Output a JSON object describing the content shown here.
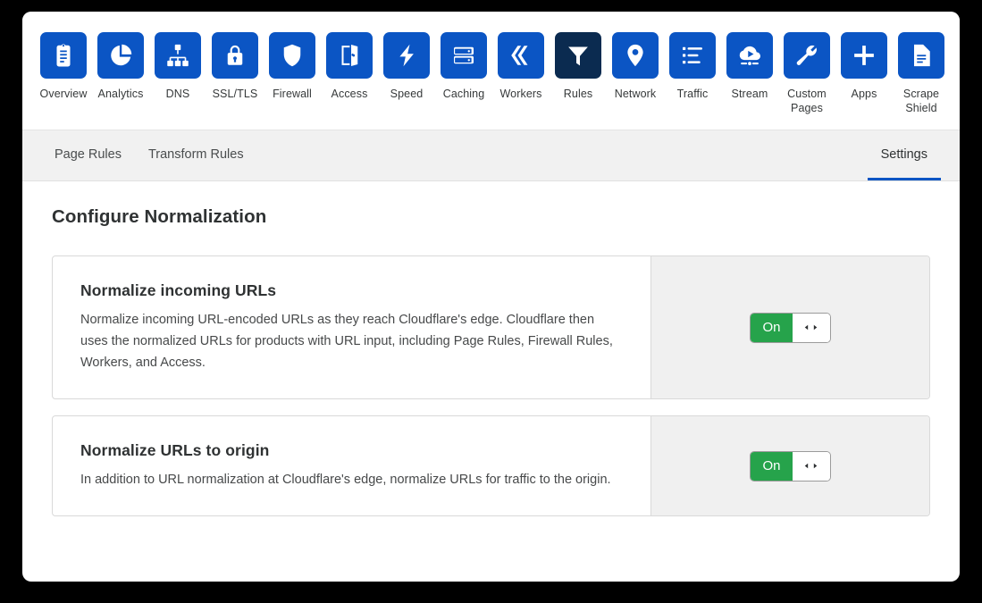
{
  "nav": {
    "items": [
      {
        "label": "Overview",
        "icon": "clipboard-icon",
        "active": false
      },
      {
        "label": "Analytics",
        "icon": "pie-chart-icon",
        "active": false
      },
      {
        "label": "DNS",
        "icon": "sitemap-icon",
        "active": false
      },
      {
        "label": "SSL/TLS",
        "icon": "lock-icon",
        "active": false
      },
      {
        "label": "Firewall",
        "icon": "shield-icon",
        "active": false
      },
      {
        "label": "Access",
        "icon": "open-door-icon",
        "active": false
      },
      {
        "label": "Speed",
        "icon": "lightning-bolt-icon",
        "active": false
      },
      {
        "label": "Caching",
        "icon": "server-stack-icon",
        "active": false
      },
      {
        "label": "Workers",
        "icon": "chevrons-icon",
        "active": false
      },
      {
        "label": "Rules",
        "icon": "funnel-icon",
        "active": true
      },
      {
        "label": "Network",
        "icon": "map-pin-icon",
        "active": false
      },
      {
        "label": "Traffic",
        "icon": "list-icon",
        "active": false
      },
      {
        "label": "Stream",
        "icon": "cloud-play-icon",
        "active": false
      },
      {
        "label": "Custom Pages",
        "icon": "wrench-icon",
        "active": false
      },
      {
        "label": "Apps",
        "icon": "plus-icon",
        "active": false
      },
      {
        "label": "Scrape Shield",
        "icon": "document-icon",
        "active": false
      }
    ]
  },
  "tabs": {
    "left": [
      {
        "label": "Page Rules",
        "active": false
      },
      {
        "label": "Transform Rules",
        "active": false
      }
    ],
    "right": [
      {
        "label": "Settings",
        "active": true
      }
    ]
  },
  "main": {
    "page_title": "Configure Normalization",
    "cards": [
      {
        "title": "Normalize incoming URLs",
        "description": "Normalize incoming URL-encoded URLs as they reach Cloudflare's edge. Cloudflare then uses the normalized URLs for products with URL input, including Page Rules, Firewall Rules, Workers, and Access.",
        "toggle_state": "On"
      },
      {
        "title": "Normalize URLs to origin",
        "description": "In addition to URL normalization at Cloudflare's edge, normalize URLs for traffic to the origin.",
        "toggle_state": "On"
      }
    ]
  },
  "colors": {
    "brand_blue": "#0b55c4",
    "active_navy": "#0b2b50",
    "toggle_green": "#26a34b",
    "panel_grey": "#f0f0f0",
    "tabstrip_grey": "#f1f1f1"
  }
}
